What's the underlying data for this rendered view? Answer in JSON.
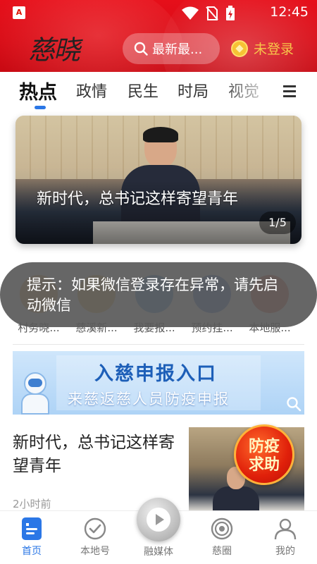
{
  "status_bar": {
    "time": "12:45",
    "app_icon_letter": "A"
  },
  "header": {
    "logo_text": "慈晓",
    "search_text": "最新最...",
    "login_text": "未登录"
  },
  "tabs": [
    {
      "label": "热点",
      "active": true
    },
    {
      "label": "政情"
    },
    {
      "label": "民生"
    },
    {
      "label": "时局"
    },
    {
      "label": "视觉"
    }
  ],
  "carousel": {
    "caption": "新时代，总书记这样寄望青年",
    "counter": "1/5"
  },
  "shortcuts": [
    {
      "label": "村务晓...",
      "color": "#e9a34a"
    },
    {
      "label": "慈溪新...",
      "color": "#e8b548"
    },
    {
      "label": "我要报...",
      "color": "#3d8ae0"
    },
    {
      "label": "预约挂...",
      "color": "#3d6fd0"
    },
    {
      "label": "本地服...",
      "color": "#e05a3a"
    }
  ],
  "toast": {
    "text": "提示：如果微信登录存在异常，请先启动微信"
  },
  "banner": {
    "title": "入慈申报入口",
    "subtitle": "来慈返慈人员防疫申报"
  },
  "news": {
    "title": "新时代，总书记这样寄望青年",
    "time": "2小时前",
    "badge_text": "防疫求助"
  },
  "bottom_nav": [
    {
      "label": "首页",
      "icon": "home-doc-icon",
      "active": true
    },
    {
      "label": "本地号",
      "icon": "check-badge-icon"
    },
    {
      "label": "融媒体",
      "icon": "play-icon"
    },
    {
      "label": "慈圈",
      "icon": "circle-target-icon"
    },
    {
      "label": "我的",
      "icon": "user-icon"
    }
  ],
  "colors": {
    "header_red": "#d70c16",
    "accent_blue": "#2b77e6",
    "login_gold": "#f7c64a"
  }
}
